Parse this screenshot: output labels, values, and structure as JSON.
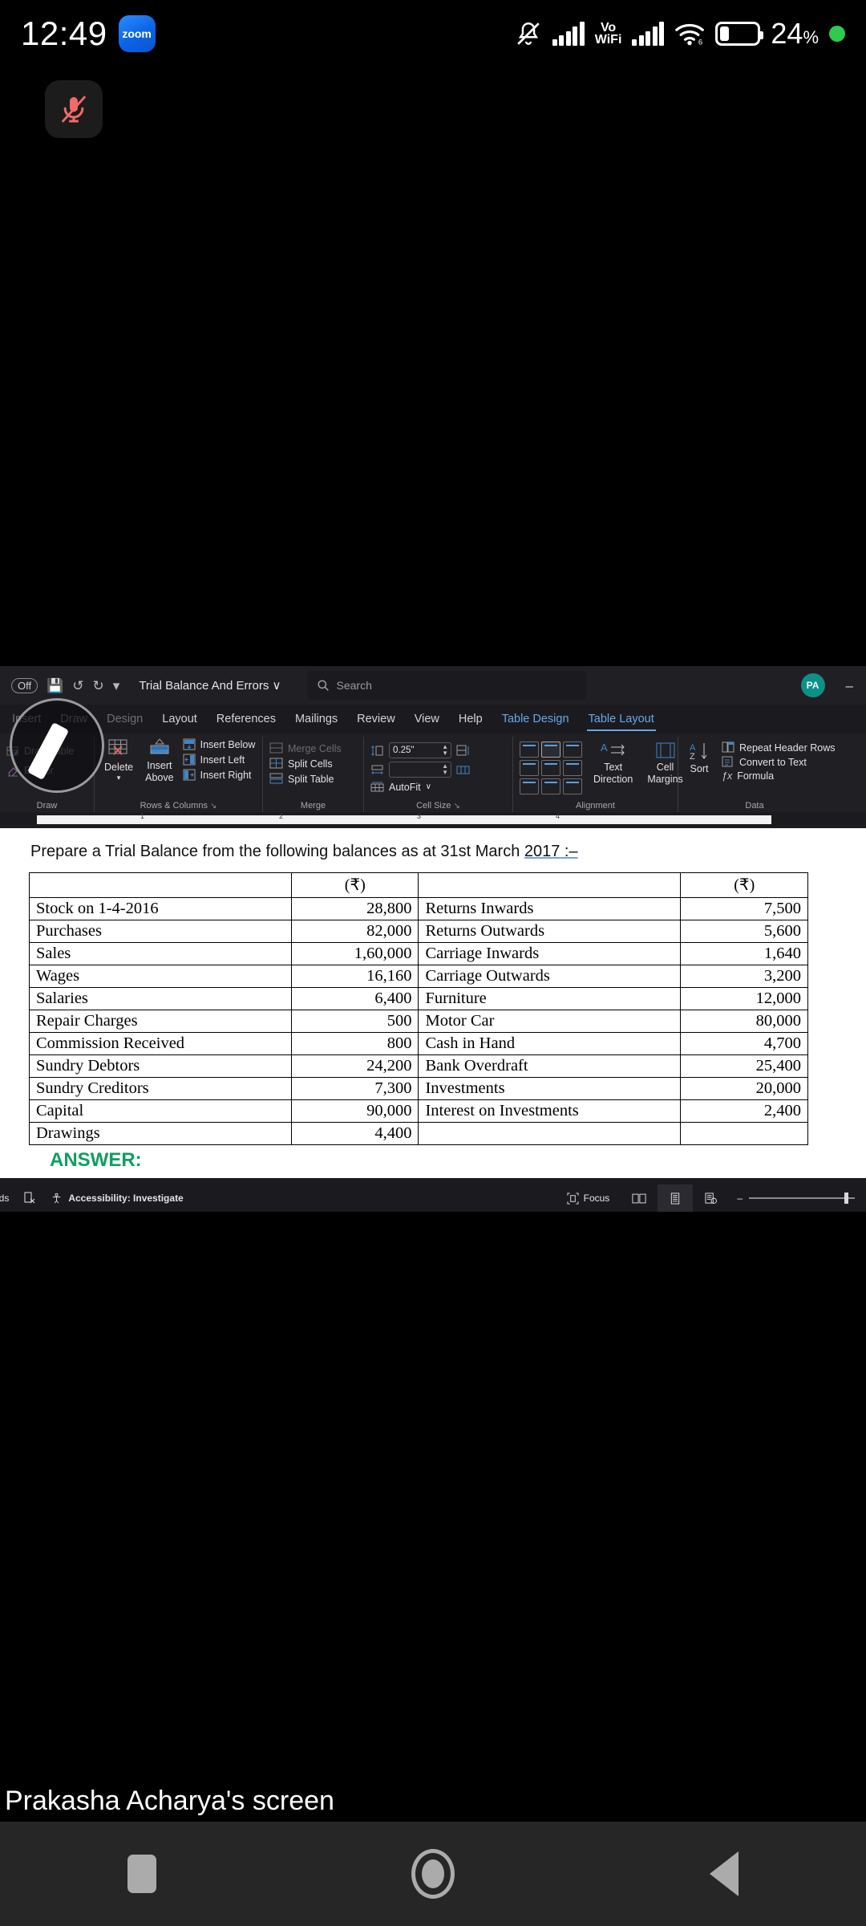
{
  "status_bar": {
    "clock": "12:49",
    "app_chip_label": "zoom",
    "vowifi_line1": "Vo",
    "vowifi_line2": "WiFi",
    "wifi_gen": "6",
    "battery_percent": "24",
    "battery_percent_symbol": "%",
    "icons": [
      "silent-bell-icon",
      "signal-bars-icon",
      "vowifi-icon",
      "signal-bars-2-icon",
      "wifi-icon",
      "battery-icon",
      "recording-dot-icon"
    ]
  },
  "floating": {
    "mic_state": "muted"
  },
  "word": {
    "title_bar": {
      "autosave_label": "Off",
      "document_name": "Trial Balance And Errors",
      "document_name_chevron": "∨",
      "search_placeholder": "Search",
      "avatar_initials": "PA",
      "minimize_label": "–"
    },
    "tabs": [
      {
        "label": "Insert",
        "state": "dim"
      },
      {
        "label": "Draw",
        "state": "dim"
      },
      {
        "label": "Design",
        "state": "dim"
      },
      {
        "label": "Layout",
        "state": "normal"
      },
      {
        "label": "References",
        "state": "normal"
      },
      {
        "label": "Mailings",
        "state": "normal"
      },
      {
        "label": "Review",
        "state": "normal"
      },
      {
        "label": "View",
        "state": "normal"
      },
      {
        "label": "Help",
        "state": "normal"
      },
      {
        "label": "Table Design",
        "state": "accent"
      },
      {
        "label": "Table Layout",
        "state": "active"
      }
    ],
    "ribbon": {
      "draw": {
        "group_label": "Draw",
        "draw_table": "Draw Table",
        "eraser": "Eraser"
      },
      "rows_columns": {
        "group_label": "Rows & Columns",
        "delete": "Delete",
        "insert_above_line1": "Insert",
        "insert_above_line2": "Above",
        "insert_below": "Insert Below",
        "insert_left": "Insert Left",
        "insert_right": "Insert Right",
        "dialog_launcher": "↘"
      },
      "merge": {
        "group_label": "Merge",
        "merge_cells": "Merge Cells",
        "split_cells": "Split Cells",
        "split_table": "Split Table"
      },
      "cell_size": {
        "group_label": "Cell Size",
        "height_value": "0.25\"",
        "width_value": "",
        "autofit": "AutoFit",
        "autofit_chevron": "∨",
        "dialog_launcher": "↘"
      },
      "alignment": {
        "group_label": "Alignment",
        "text_direction_line1": "Text",
        "text_direction_line2": "Direction",
        "cell_margins_line1": "Cell",
        "cell_margins_line2": "Margins"
      },
      "data": {
        "group_label": "Data",
        "sort": "Sort",
        "repeat_header_rows": "Repeat Header Rows",
        "convert_to_text": "Convert to Text",
        "formula": "Formula",
        "formula_icon": "ƒx"
      }
    },
    "ruler": {
      "marks": [
        "1",
        "2",
        "3",
        "4"
      ]
    },
    "document": {
      "question": "Prepare a Trial Balance from the following balances as at 31st March ",
      "question_year": "2017",
      "question_tail": " :–",
      "currency_header": "(₹)",
      "answer_label": "ANSWER:",
      "left_column": [
        {
          "name": "Stock on 1-4-2016",
          "amount": "28,800"
        },
        {
          "name": "Purchases",
          "amount": "82,000"
        },
        {
          "name": "Sales",
          "amount": "1,60,000"
        },
        {
          "name": "Wages",
          "amount": "16,160"
        },
        {
          "name": "Salaries",
          "amount": "6,400"
        },
        {
          "name": "Repair Charges",
          "amount": "500"
        },
        {
          "name": "Commission Received",
          "amount": "800"
        },
        {
          "name": "Sundry Debtors",
          "amount": "24,200"
        },
        {
          "name": "Sundry Creditors",
          "amount": "7,300"
        },
        {
          "name": "Capital",
          "amount": "90,000"
        },
        {
          "name": "Drawings",
          "amount": "4,400"
        }
      ],
      "right_column": [
        {
          "name": "Returns Inwards",
          "amount": "7,500"
        },
        {
          "name": "Returns Outwards",
          "amount": "5,600"
        },
        {
          "name": "Carriage Inwards",
          "amount": "1,640"
        },
        {
          "name": "Carriage Outwards",
          "amount": "3,200"
        },
        {
          "name": "Furniture",
          "amount": "12,000"
        },
        {
          "name": "Motor Car",
          "amount": "80,000"
        },
        {
          "name": "Cash in Hand",
          "amount": "4,700"
        },
        {
          "name": "Bank Overdraft",
          "amount": "25,400"
        },
        {
          "name": "Investments",
          "amount": "20,000"
        },
        {
          "name": "Interest on Investments",
          "amount": "2,400"
        },
        {
          "name": "",
          "amount": ""
        }
      ]
    },
    "status_bar": {
      "words_label": "ords",
      "accessibility": "Accessibility: Investigate",
      "focus": "Focus",
      "zoom_minus": "–"
    }
  },
  "share_banner": {
    "text": "Prakasha Acharya's screen"
  },
  "nav_bar": {
    "items": [
      "recents-button",
      "home-button",
      "back-button"
    ]
  },
  "colors": {
    "accent_blue": "#68a7e8",
    "answer_green": "#0f9e63",
    "avatar_teal": "#0f8f8a",
    "mic_red": "#f26a6a",
    "zoom_blue": "#0b63e5",
    "record_green": "#2ecb4f"
  }
}
